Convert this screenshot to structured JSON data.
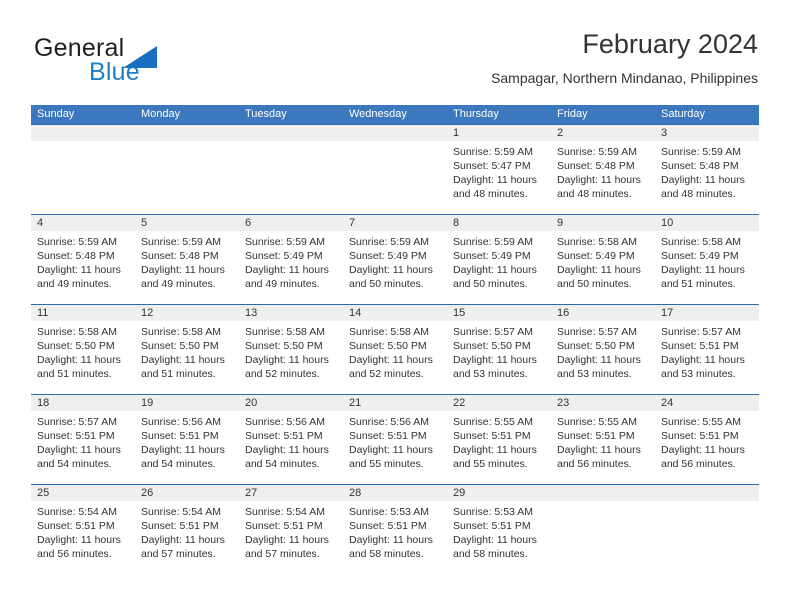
{
  "brand": {
    "word1": "General",
    "word2": "Blue",
    "icon": "triangle-logo"
  },
  "header": {
    "title": "February 2024",
    "subtitle": "Sampagar, Northern Mindanao, Philippines"
  },
  "calendar": {
    "weekdays": [
      "Sunday",
      "Monday",
      "Tuesday",
      "Wednesday",
      "Thursday",
      "Friday",
      "Saturday"
    ],
    "colors": {
      "header_blue": "#3b78bd",
      "row_rule": "#2f6ba8",
      "daynum_band": "#efefef",
      "brand_blue": "#1d7fc3",
      "text": "#333333"
    },
    "weeks": [
      [
        {
          "day": "",
          "sunrise": "",
          "sunset": "",
          "daylight1": "",
          "daylight2": ""
        },
        {
          "day": "",
          "sunrise": "",
          "sunset": "",
          "daylight1": "",
          "daylight2": ""
        },
        {
          "day": "",
          "sunrise": "",
          "sunset": "",
          "daylight1": "",
          "daylight2": ""
        },
        {
          "day": "",
          "sunrise": "",
          "sunset": "",
          "daylight1": "",
          "daylight2": ""
        },
        {
          "day": "1",
          "sunrise": "Sunrise: 5:59 AM",
          "sunset": "Sunset: 5:47 PM",
          "daylight1": "Daylight: 11 hours",
          "daylight2": "and 48 minutes."
        },
        {
          "day": "2",
          "sunrise": "Sunrise: 5:59 AM",
          "sunset": "Sunset: 5:48 PM",
          "daylight1": "Daylight: 11 hours",
          "daylight2": "and 48 minutes."
        },
        {
          "day": "3",
          "sunrise": "Sunrise: 5:59 AM",
          "sunset": "Sunset: 5:48 PM",
          "daylight1": "Daylight: 11 hours",
          "daylight2": "and 48 minutes."
        }
      ],
      [
        {
          "day": "4",
          "sunrise": "Sunrise: 5:59 AM",
          "sunset": "Sunset: 5:48 PM",
          "daylight1": "Daylight: 11 hours",
          "daylight2": "and 49 minutes."
        },
        {
          "day": "5",
          "sunrise": "Sunrise: 5:59 AM",
          "sunset": "Sunset: 5:48 PM",
          "daylight1": "Daylight: 11 hours",
          "daylight2": "and 49 minutes."
        },
        {
          "day": "6",
          "sunrise": "Sunrise: 5:59 AM",
          "sunset": "Sunset: 5:49 PM",
          "daylight1": "Daylight: 11 hours",
          "daylight2": "and 49 minutes."
        },
        {
          "day": "7",
          "sunrise": "Sunrise: 5:59 AM",
          "sunset": "Sunset: 5:49 PM",
          "daylight1": "Daylight: 11 hours",
          "daylight2": "and 50 minutes."
        },
        {
          "day": "8",
          "sunrise": "Sunrise: 5:59 AM",
          "sunset": "Sunset: 5:49 PM",
          "daylight1": "Daylight: 11 hours",
          "daylight2": "and 50 minutes."
        },
        {
          "day": "9",
          "sunrise": "Sunrise: 5:58 AM",
          "sunset": "Sunset: 5:49 PM",
          "daylight1": "Daylight: 11 hours",
          "daylight2": "and 50 minutes."
        },
        {
          "day": "10",
          "sunrise": "Sunrise: 5:58 AM",
          "sunset": "Sunset: 5:49 PM",
          "daylight1": "Daylight: 11 hours",
          "daylight2": "and 51 minutes."
        }
      ],
      [
        {
          "day": "11",
          "sunrise": "Sunrise: 5:58 AM",
          "sunset": "Sunset: 5:50 PM",
          "daylight1": "Daylight: 11 hours",
          "daylight2": "and 51 minutes."
        },
        {
          "day": "12",
          "sunrise": "Sunrise: 5:58 AM",
          "sunset": "Sunset: 5:50 PM",
          "daylight1": "Daylight: 11 hours",
          "daylight2": "and 51 minutes."
        },
        {
          "day": "13",
          "sunrise": "Sunrise: 5:58 AM",
          "sunset": "Sunset: 5:50 PM",
          "daylight1": "Daylight: 11 hours",
          "daylight2": "and 52 minutes."
        },
        {
          "day": "14",
          "sunrise": "Sunrise: 5:58 AM",
          "sunset": "Sunset: 5:50 PM",
          "daylight1": "Daylight: 11 hours",
          "daylight2": "and 52 minutes."
        },
        {
          "day": "15",
          "sunrise": "Sunrise: 5:57 AM",
          "sunset": "Sunset: 5:50 PM",
          "daylight1": "Daylight: 11 hours",
          "daylight2": "and 53 minutes."
        },
        {
          "day": "16",
          "sunrise": "Sunrise: 5:57 AM",
          "sunset": "Sunset: 5:50 PM",
          "daylight1": "Daylight: 11 hours",
          "daylight2": "and 53 minutes."
        },
        {
          "day": "17",
          "sunrise": "Sunrise: 5:57 AM",
          "sunset": "Sunset: 5:51 PM",
          "daylight1": "Daylight: 11 hours",
          "daylight2": "and 53 minutes."
        }
      ],
      [
        {
          "day": "18",
          "sunrise": "Sunrise: 5:57 AM",
          "sunset": "Sunset: 5:51 PM",
          "daylight1": "Daylight: 11 hours",
          "daylight2": "and 54 minutes."
        },
        {
          "day": "19",
          "sunrise": "Sunrise: 5:56 AM",
          "sunset": "Sunset: 5:51 PM",
          "daylight1": "Daylight: 11 hours",
          "daylight2": "and 54 minutes."
        },
        {
          "day": "20",
          "sunrise": "Sunrise: 5:56 AM",
          "sunset": "Sunset: 5:51 PM",
          "daylight1": "Daylight: 11 hours",
          "daylight2": "and 54 minutes."
        },
        {
          "day": "21",
          "sunrise": "Sunrise: 5:56 AM",
          "sunset": "Sunset: 5:51 PM",
          "daylight1": "Daylight: 11 hours",
          "daylight2": "and 55 minutes."
        },
        {
          "day": "22",
          "sunrise": "Sunrise: 5:55 AM",
          "sunset": "Sunset: 5:51 PM",
          "daylight1": "Daylight: 11 hours",
          "daylight2": "and 55 minutes."
        },
        {
          "day": "23",
          "sunrise": "Sunrise: 5:55 AM",
          "sunset": "Sunset: 5:51 PM",
          "daylight1": "Daylight: 11 hours",
          "daylight2": "and 56 minutes."
        },
        {
          "day": "24",
          "sunrise": "Sunrise: 5:55 AM",
          "sunset": "Sunset: 5:51 PM",
          "daylight1": "Daylight: 11 hours",
          "daylight2": "and 56 minutes."
        }
      ],
      [
        {
          "day": "25",
          "sunrise": "Sunrise: 5:54 AM",
          "sunset": "Sunset: 5:51 PM",
          "daylight1": "Daylight: 11 hours",
          "daylight2": "and 56 minutes."
        },
        {
          "day": "26",
          "sunrise": "Sunrise: 5:54 AM",
          "sunset": "Sunset: 5:51 PM",
          "daylight1": "Daylight: 11 hours",
          "daylight2": "and 57 minutes."
        },
        {
          "day": "27",
          "sunrise": "Sunrise: 5:54 AM",
          "sunset": "Sunset: 5:51 PM",
          "daylight1": "Daylight: 11 hours",
          "daylight2": "and 57 minutes."
        },
        {
          "day": "28",
          "sunrise": "Sunrise: 5:53 AM",
          "sunset": "Sunset: 5:51 PM",
          "daylight1": "Daylight: 11 hours",
          "daylight2": "and 58 minutes."
        },
        {
          "day": "29",
          "sunrise": "Sunrise: 5:53 AM",
          "sunset": "Sunset: 5:51 PM",
          "daylight1": "Daylight: 11 hours",
          "daylight2": "and 58 minutes."
        },
        {
          "day": "",
          "sunrise": "",
          "sunset": "",
          "daylight1": "",
          "daylight2": ""
        },
        {
          "day": "",
          "sunrise": "",
          "sunset": "",
          "daylight1": "",
          "daylight2": ""
        }
      ]
    ]
  }
}
